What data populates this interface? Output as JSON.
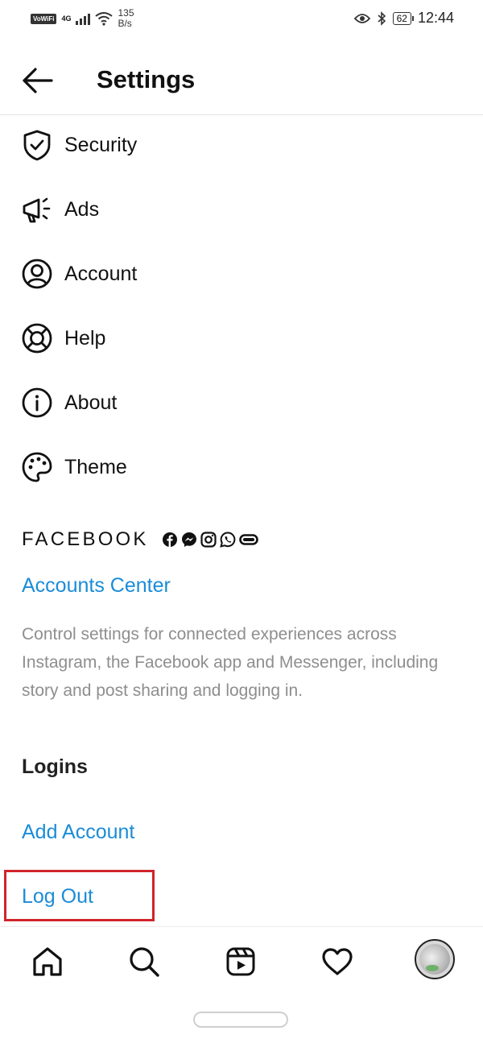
{
  "status_bar": {
    "vowifi": "VoWiFi",
    "network": "4G",
    "speed_value": "135",
    "speed_unit": "B/s",
    "battery": "62",
    "time": "12:44"
  },
  "header": {
    "title": "Settings",
    "back_icon": "arrow-left-icon"
  },
  "menu": [
    {
      "label": "Security",
      "icon": "shield-check-icon"
    },
    {
      "label": "Ads",
      "icon": "megaphone-icon"
    },
    {
      "label": "Account",
      "icon": "user-circle-icon"
    },
    {
      "label": "Help",
      "icon": "lifebuoy-icon"
    },
    {
      "label": "About",
      "icon": "info-icon"
    },
    {
      "label": "Theme",
      "icon": "palette-icon"
    }
  ],
  "facebook_section": {
    "label": "FACEBOOK",
    "icons": [
      "facebook-icon",
      "messenger-icon",
      "instagram-icon",
      "whatsapp-icon",
      "portal-icon"
    ],
    "accounts_center_link": "Accounts Center",
    "description": "Control settings for connected experiences across Instagram, the Facebook app and Messenger, including story and post sharing and logging in."
  },
  "logins": {
    "title": "Logins",
    "add_account": "Add Account",
    "log_out": "Log Out"
  },
  "tab_bar": {
    "tabs": [
      "home-icon",
      "search-icon",
      "reels-icon",
      "heart-icon",
      "profile-avatar"
    ]
  },
  "colors": {
    "link": "#1a8cd8",
    "description": "#8e8e8e",
    "highlight_box": "#d0242b",
    "text": "#111111"
  }
}
